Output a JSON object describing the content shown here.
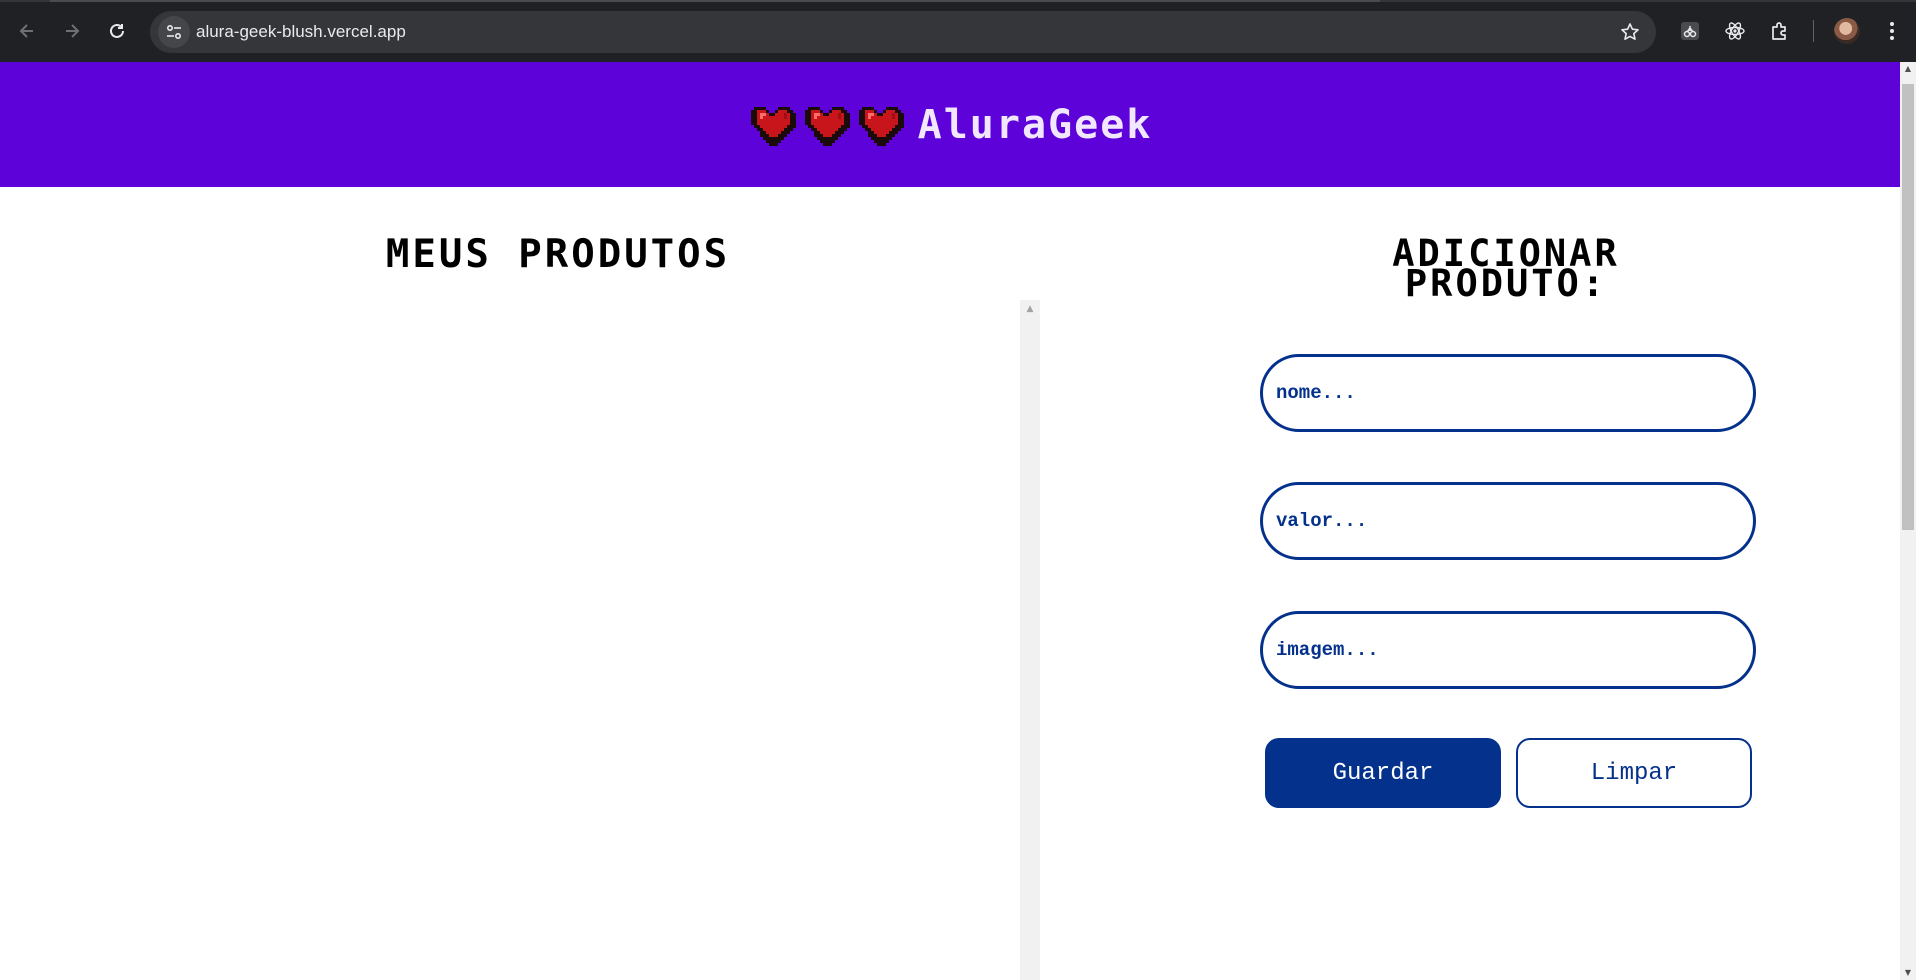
{
  "browser": {
    "url": "alura-geek-blush.vercel.app",
    "icons": [
      "back-icon",
      "forward-icon",
      "reload-icon",
      "site-info-icon",
      "star-icon",
      "extension-puzzle-icon",
      "react-devtools-icon",
      "extensions-icon",
      "profile-avatar",
      "kebab-menu-icon"
    ]
  },
  "header": {
    "brand": "AluraGeek",
    "heart_count": 3,
    "background": "#5d03da"
  },
  "products": {
    "title": "MEUS PRODUTOS",
    "items": []
  },
  "form": {
    "title_line1": "ADICIONAR",
    "title_line2": "PRODUTO:",
    "name_placeholder": "nome...",
    "price_placeholder": "valor...",
    "image_placeholder": "imagem...",
    "save_label": "Guardar",
    "clear_label": "Limpar",
    "accent": "#03318c"
  }
}
